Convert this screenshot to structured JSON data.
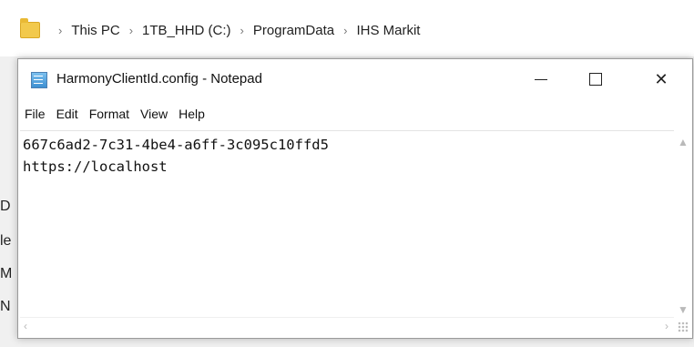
{
  "explorer": {
    "breadcrumbs": [
      "This PC",
      "1TB_HHD (C:)",
      "ProgramData",
      "IHS Markit"
    ],
    "left_fragments": [
      "D",
      "le",
      "M",
      "N"
    ]
  },
  "notepad": {
    "title": "HarmonyClientId.config - Notepad",
    "menu": [
      "File",
      "Edit",
      "Format",
      "View",
      "Help"
    ],
    "lines": [
      "667c6ad2-7c31-4be4-a6ff-3c095c10ffd5",
      "https://localhost"
    ],
    "buttons": {
      "close_glyph": "✕"
    }
  },
  "icons": {
    "folder": "folder-icon",
    "notepad": "notepad-icon"
  }
}
